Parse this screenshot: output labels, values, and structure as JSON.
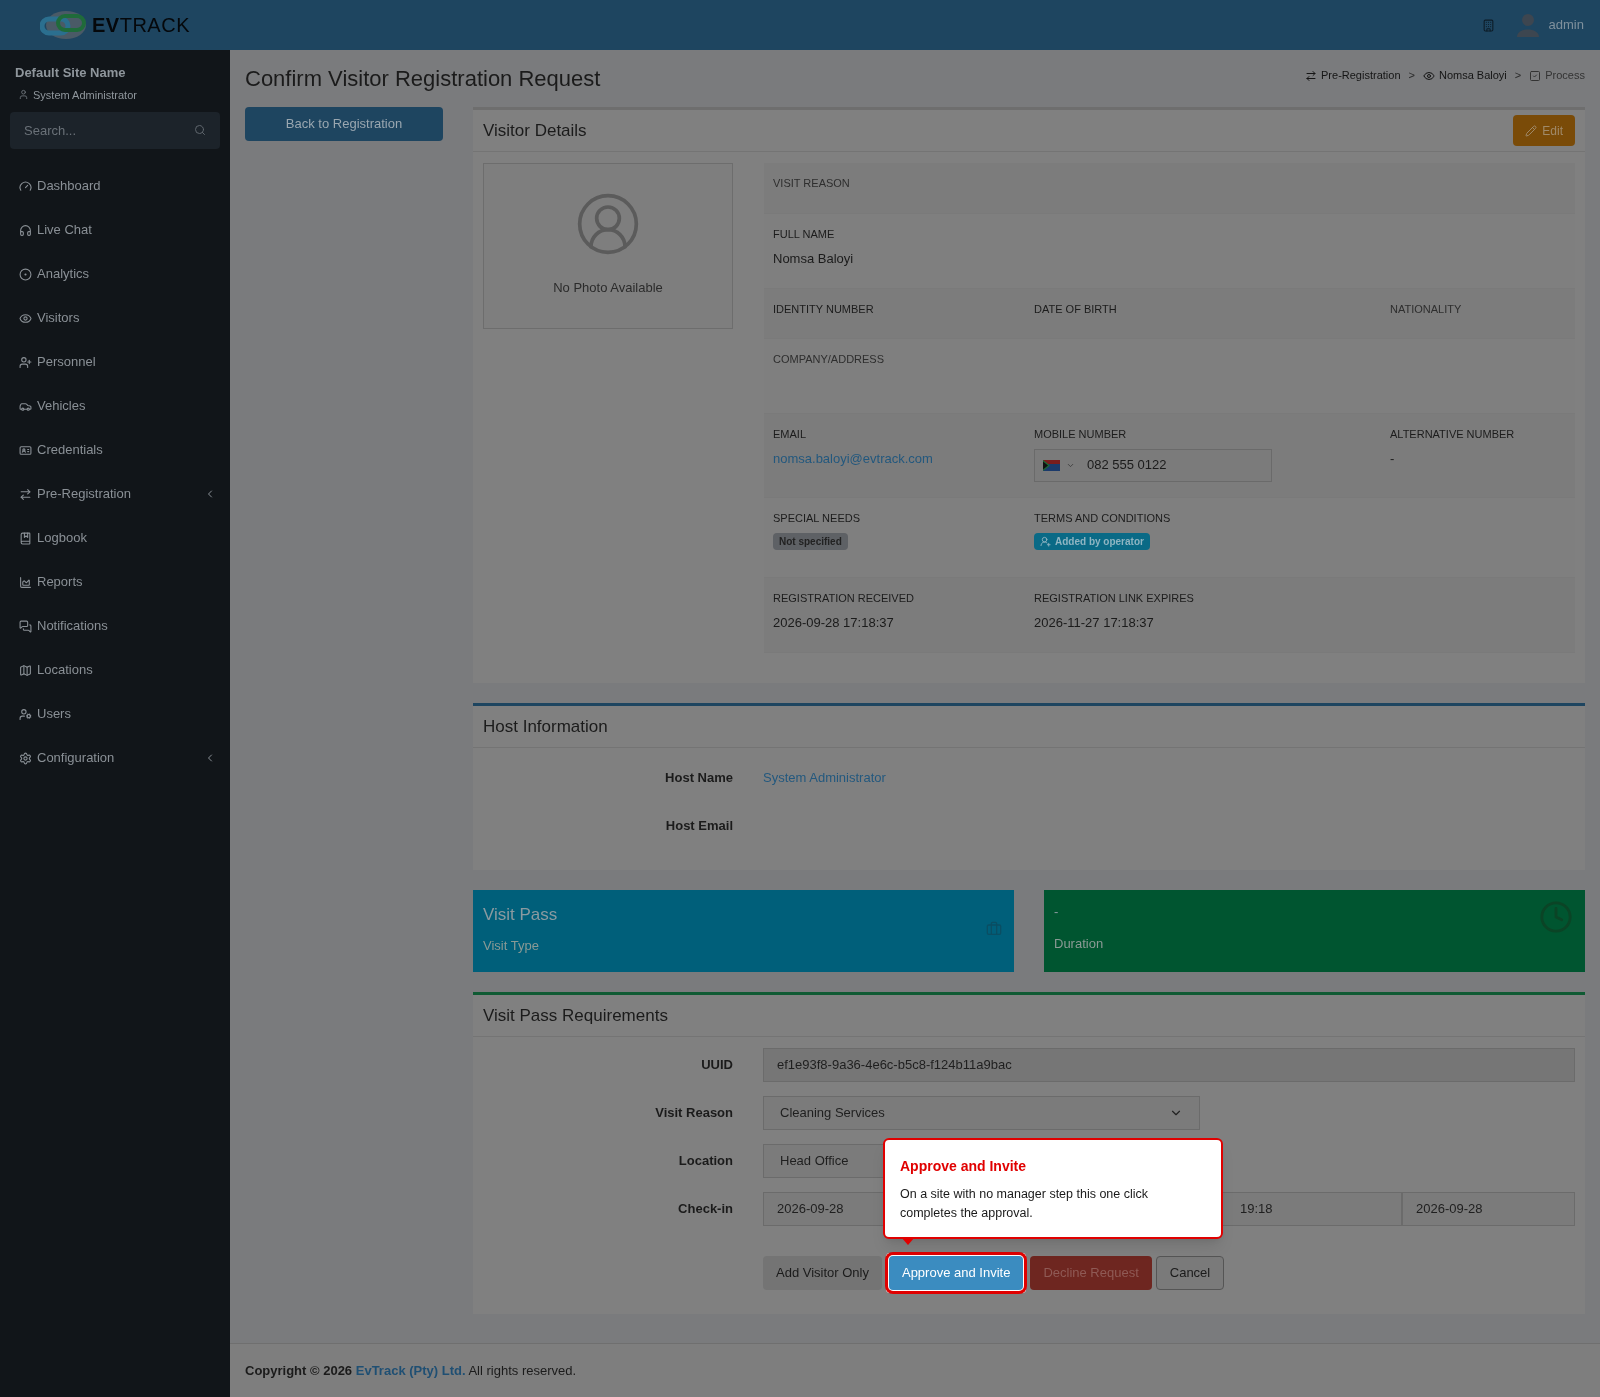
{
  "topbar": {
    "brand_bold": "EV",
    "brand_light": "TRACK",
    "user": "admin"
  },
  "sidebar": {
    "site_name": "Default Site Name",
    "role": "System Administrator",
    "search": {
      "placeholder": "Search..."
    },
    "items": [
      {
        "label": "Dashboard",
        "submenu": false
      },
      {
        "label": "Live Chat",
        "submenu": false
      },
      {
        "label": "Analytics",
        "submenu": false
      },
      {
        "label": "Visitors",
        "submenu": false
      },
      {
        "label": "Personnel",
        "submenu": false
      },
      {
        "label": "Vehicles",
        "submenu": false
      },
      {
        "label": "Credentials",
        "submenu": false
      },
      {
        "label": "Pre-Registration",
        "submenu": true
      },
      {
        "label": "Logbook",
        "submenu": false
      },
      {
        "label": "Reports",
        "submenu": false
      },
      {
        "label": "Notifications",
        "submenu": false
      },
      {
        "label": "Locations",
        "submenu": false
      },
      {
        "label": "Users",
        "submenu": false
      },
      {
        "label": "Configuration",
        "submenu": true
      }
    ]
  },
  "page_title": "Confirm Visitor Registration Request",
  "breadcrumb": [
    {
      "label": "Pre-Registration",
      "current": false
    },
    {
      "separator": ">",
      "label": "Nomsa Baloyi",
      "current": false
    },
    {
      "separator": ">",
      "label": "Process",
      "current": true
    }
  ],
  "back_button": "Back to Registration",
  "visitor_details": {
    "title": "Visitor Details",
    "edit_button": "Edit",
    "photo_caption": "No Photo Available",
    "rows": [
      [
        {
          "label": "VISIT REASON",
          "kind": "empty"
        }
      ],
      [
        {
          "label": "FULL NAME",
          "kind": "text",
          "value": "Nomsa Baloyi"
        }
      ],
      [
        {
          "label": "IDENTITY NUMBER",
          "kind": "empty"
        },
        {
          "label": "DATE OF BIRTH",
          "kind": "empty"
        },
        {
          "label": "NATIONALITY",
          "kind": "empty"
        }
      ],
      [
        {
          "label": "COMPANY/ADDRESS",
          "kind": "empty"
        }
      ],
      [
        {
          "label": "EMAIL",
          "kind": "link",
          "value": "nomsa.baloyi@evtrack.com"
        },
        {
          "label": "MOBILE NUMBER",
          "kind": "phone",
          "value": "082 555 0122"
        },
        {
          "label": "ALTERNATIVE NUMBER",
          "kind": "text",
          "value": "-"
        }
      ],
      [
        {
          "label": "SPECIAL NEEDS",
          "kind": "badge",
          "value": "Not specified"
        },
        {
          "label": "TERMS AND CONDITIONS",
          "kind": "operator",
          "value": "Added by operator"
        }
      ],
      [
        {
          "label": "REGISTRATION RECEIVED",
          "kind": "text",
          "value": "2026-09-28 17:18:37"
        },
        {
          "label": "REGISTRATION LINK EXPIRES",
          "kind": "text",
          "value": "2026-11-27 17:18:37"
        }
      ]
    ]
  },
  "host": {
    "title": "Host Information",
    "rows": [
      {
        "label": "Host Name",
        "value": "System Administrator"
      },
      {
        "label": "Host Email"
      }
    ]
  },
  "tiles": [
    {
      "kind": "pass",
      "title": "Visit Pass",
      "subtitle": "Visit Type"
    },
    {
      "kind": "duration",
      "title": "-",
      "subtitle": "Duration"
    }
  ],
  "requirements": {
    "title": "Visit Pass Requirements",
    "uuid": {
      "label": "UUID",
      "value": "ef1e93f8-9a36-4e6c-b5c8-f124b11a9bac"
    },
    "visit_reason": {
      "label": "Visit Reason",
      "value": "Cleaning Services"
    },
    "location": {
      "label": "Location",
      "value": "Head Office"
    },
    "check_in": {
      "label": "Check-in",
      "values": [
        "2026-09-28",
        "19:18",
        "2026-09-28"
      ]
    },
    "buttons": [
      {
        "label": "Add Visitor Only",
        "kind": "secondary",
        "highlighted": false
      },
      {
        "label": "Approve and Invite",
        "kind": "primary",
        "highlighted": true
      },
      {
        "label": "Decline Request",
        "kind": "danger",
        "highlighted": false
      },
      {
        "label": "Cancel",
        "kind": "default",
        "highlighted": false
      }
    ]
  },
  "tooltip": {
    "title": "Approve and Invite",
    "body": "On a site with no manager step this one click completes the approval."
  },
  "footer": {
    "prefix": "Copyright © 2026",
    "company": "EvTrack (Pty) Ltd.",
    "suffix": "All rights reserved."
  }
}
